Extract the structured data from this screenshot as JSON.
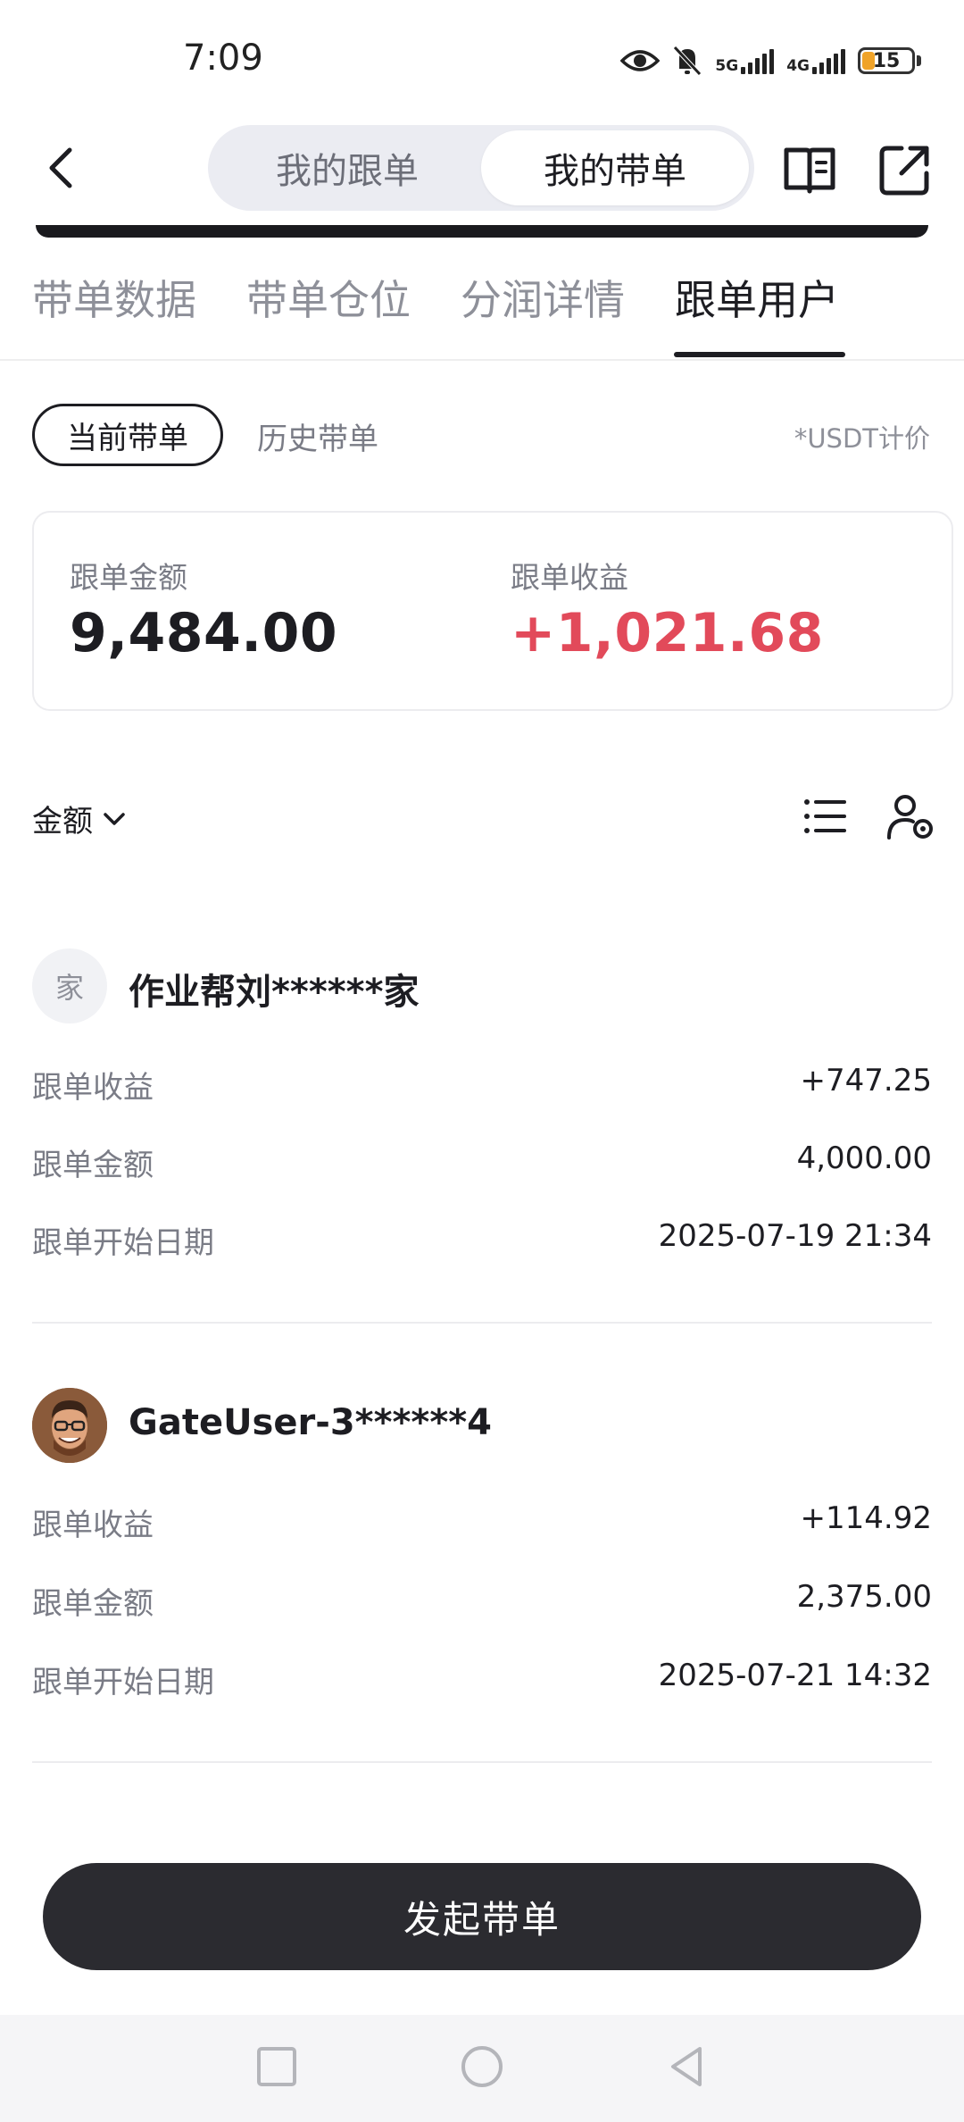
{
  "status_bar": {
    "time": "7:09",
    "network_1": "5G",
    "network_2": "4G",
    "battery": "15",
    "icons": [
      "eye-icon",
      "bell-off-icon",
      "signal-icon",
      "signal-icon",
      "battery-icon"
    ]
  },
  "header": {
    "segments": [
      {
        "label": "我的跟单",
        "active": false
      },
      {
        "label": "我的带单",
        "active": true
      }
    ],
    "icons": [
      "back-icon",
      "book-icon",
      "share-icon"
    ]
  },
  "tabs": [
    {
      "label": "带单数据",
      "active": false
    },
    {
      "label": "带单仓位",
      "active": false
    },
    {
      "label": "分润详情",
      "active": false
    },
    {
      "label": "跟单用户",
      "active": true
    }
  ],
  "filter": {
    "current": "当前带单",
    "history": "历史带单",
    "note": "*USDT计价"
  },
  "summary": {
    "amount_label": "跟单金额",
    "amount_value": "9,484.00",
    "profit_label": "跟单收益",
    "profit_value": "+1,021.68"
  },
  "sort": {
    "label": "金额",
    "icons": [
      "chevron-down-icon",
      "list-icon",
      "user-settings-icon"
    ]
  },
  "followers": [
    {
      "avatar_text": "家",
      "name": "作业帮刘******家",
      "rows": [
        {
          "label": "跟单收益",
          "value": "+747.25"
        },
        {
          "label": "跟单金额",
          "value": "4,000.00"
        },
        {
          "label": "跟单开始日期",
          "value": "2025-07-19 21:34"
        }
      ]
    },
    {
      "avatar_text": "",
      "name": "GateUser-3******4",
      "rows": [
        {
          "label": "跟单收益",
          "value": "+114.92"
        },
        {
          "label": "跟单金额",
          "value": "2,375.00"
        },
        {
          "label": "跟单开始日期",
          "value": "2025-07-21 14:32"
        }
      ]
    }
  ],
  "cta": {
    "label": "发起带单"
  },
  "colors": {
    "accent_red": "#e24a5a",
    "dark": "#2b2b30",
    "battery": "#f0a328"
  },
  "nav_bar": {
    "icons": [
      "square-icon",
      "circle-icon",
      "triangle-back-icon"
    ]
  }
}
